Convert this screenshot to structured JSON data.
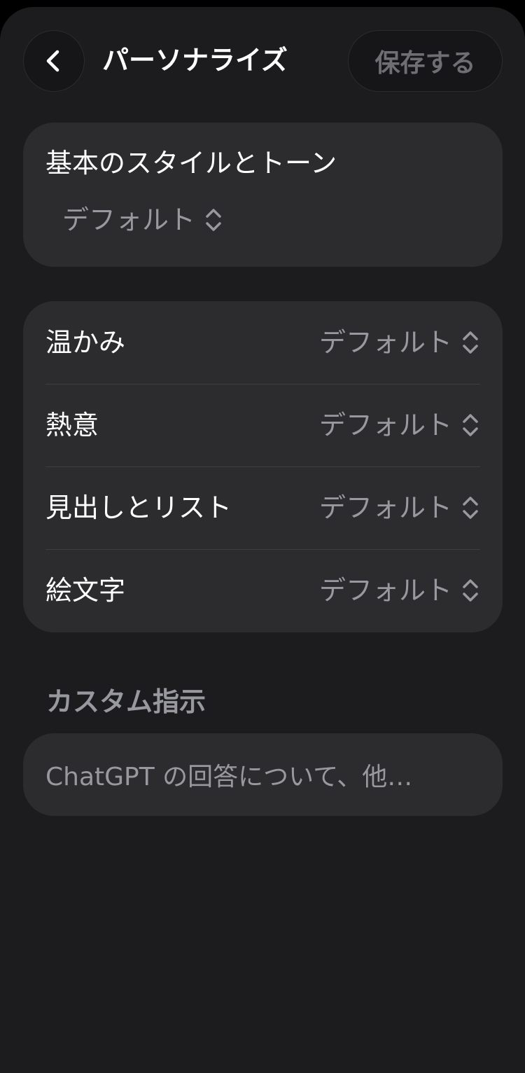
{
  "header": {
    "title": "パーソナライズ",
    "save_label": "保存する"
  },
  "base_style": {
    "label": "基本のスタイルとトーン",
    "value": "デフォルト"
  },
  "traits": [
    {
      "label": "温かみ",
      "value": "デフォルト"
    },
    {
      "label": "熱意",
      "value": "デフォルト"
    },
    {
      "label": "見出しとリスト",
      "value": "デフォルト"
    },
    {
      "label": "絵文字",
      "value": "デフォルト"
    }
  ],
  "custom_instructions": {
    "heading": "カスタム指示",
    "placeholder": "ChatGPT の回答について、他…"
  },
  "icons": {
    "back": "chevron-left-icon",
    "picker": "chevron-up-down-icon"
  },
  "colors": {
    "background": "#1c1c1e",
    "card": "#2c2c2e",
    "secondary_text": "#98989f",
    "disabled_text": "#6e6e73"
  }
}
